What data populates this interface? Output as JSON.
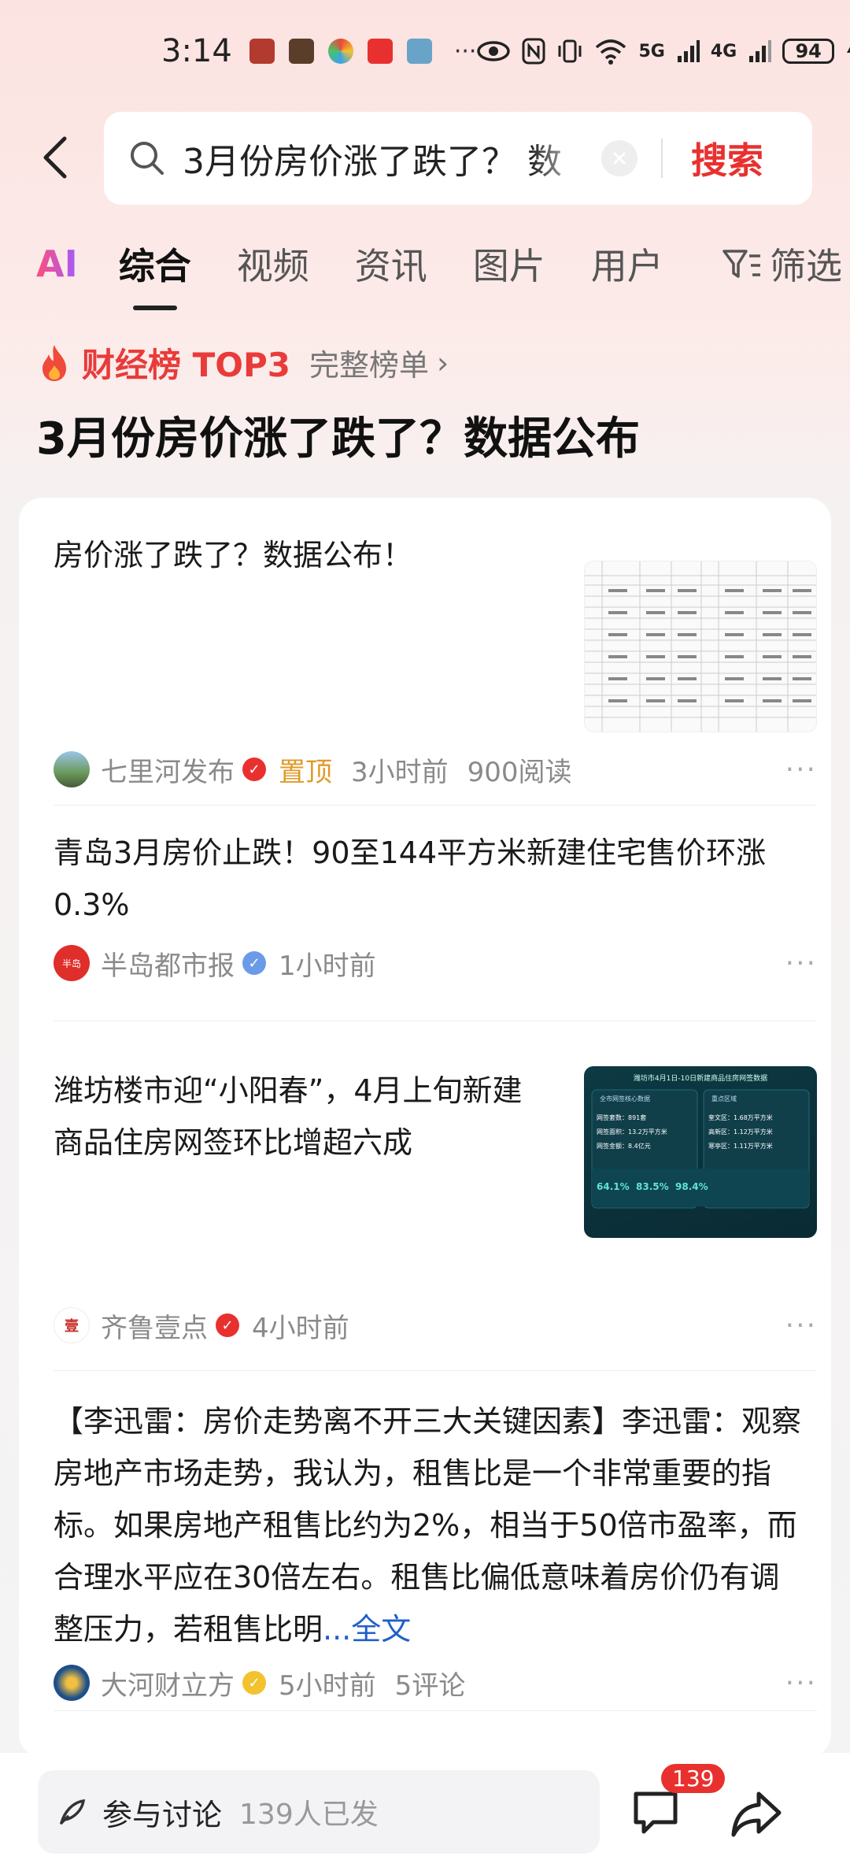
{
  "status": {
    "time": "3:14",
    "signal1": "5G",
    "signal2": "4G",
    "battery": "94",
    "more": "···"
  },
  "search": {
    "query": "3月份房价涨了跌了？ 数",
    "button": "搜索"
  },
  "tabs": [
    {
      "label": "AI"
    },
    {
      "label": "综合"
    },
    {
      "label": "视频"
    },
    {
      "label": "资讯"
    },
    {
      "label": "图片"
    },
    {
      "label": "用户"
    }
  ],
  "filter_label": "筛选",
  "ranking": {
    "title": "财经榜 TOP3",
    "link": "完整榜单",
    "chevron": "›",
    "headline": "3月份房价涨了跌了？数据公布"
  },
  "items": [
    {
      "title": "房价涨了跌了？数据公布！",
      "source": "七里河发布",
      "pinned": "置顶",
      "time": "3小时前",
      "stat": "900阅读"
    },
    {
      "title": "青岛3月房价止跌！90至144平方米新建住宅售价环涨0.3%",
      "source": "半岛都市报",
      "time": "1小时前"
    },
    {
      "title": "潍坊楼市迎“小阳春”，4月上旬新建商品住房网签环比增超六成",
      "source": "齐鲁壹点",
      "time": "4小时前",
      "thumb": {
        "header": "潍坊市4月1日-10日新建商品住房网签数据",
        "left_title": "全市网签核心数据",
        "right_title": "重点区域",
        "l1": "网签套数：891套",
        "l2": "网签面积：13.2万平方米",
        "l3": "网签金额：8.4亿元",
        "r1": "奎文区：1.68万平方米",
        "r2": "高新区：1.12万平方米",
        "r3": "寒亭区：1.11万平方米",
        "p1": "64.1%",
        "p2": "83.5%",
        "p3": "98.4%"
      }
    },
    {
      "title": "【李迅雷：房价走势离不开三大关键因素】李迅雷：观察房地产市场走势，我认为，租售比是一个非常重要的指标。如果房地产租售比约为2%，相当于50倍市盈率，而合理水平应在30倍左右。租售比偏低意味着房价仍有调整压力，若租售比明",
      "read_more": "...全文",
      "source": "大河财立方",
      "time": "5小时前",
      "stat": "5评论"
    }
  ],
  "more_label": "···",
  "bottom": {
    "discuss": "参与讨论",
    "discuss_count": "139人已发",
    "comment_count": "139"
  }
}
